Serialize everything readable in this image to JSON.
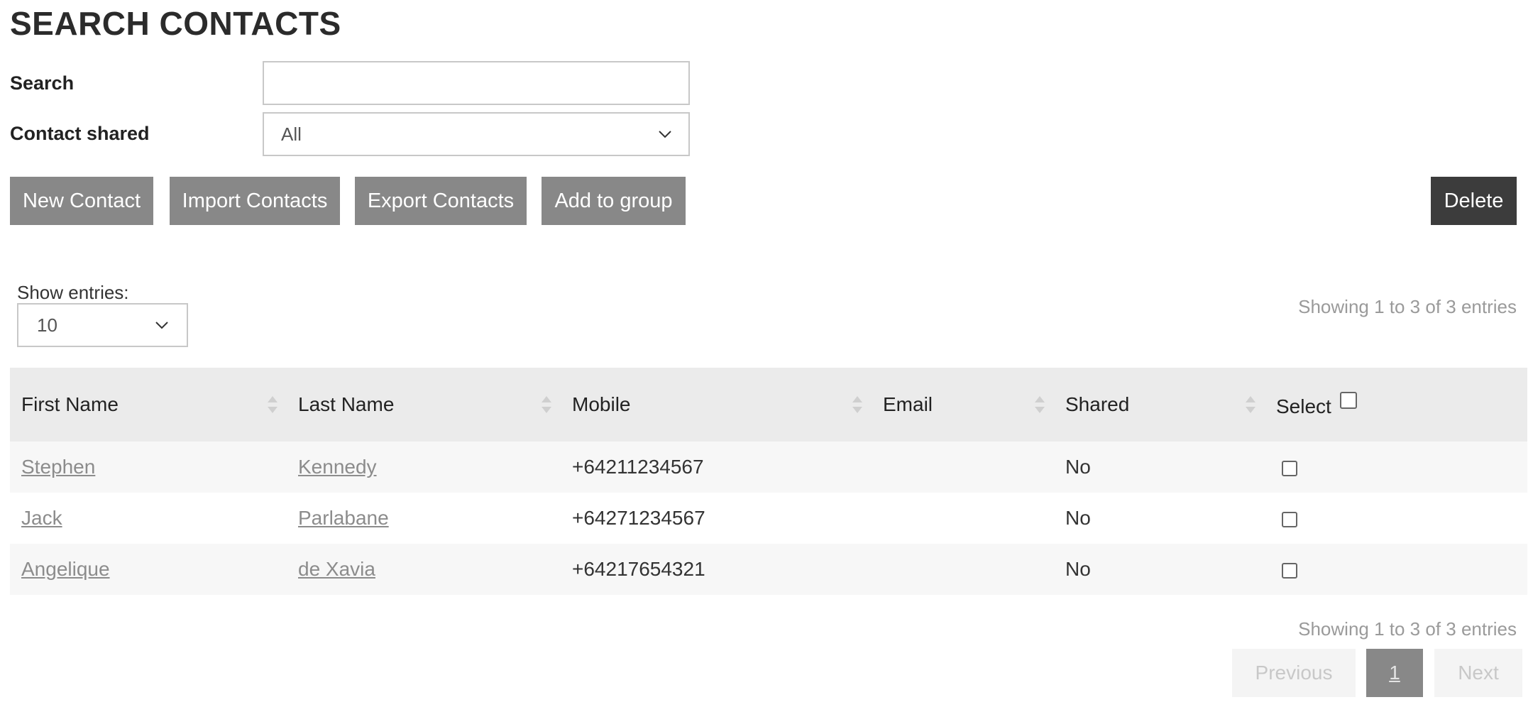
{
  "page": {
    "title": "SEARCH CONTACTS"
  },
  "filters": {
    "search_label": "Search",
    "search_value": "",
    "shared_label": "Contact shared",
    "shared_value": "All"
  },
  "toolbar": {
    "new_contact": "New Contact",
    "import_contacts": "Import Contacts",
    "export_contacts": "Export Contacts",
    "add_to_group": "Add to group",
    "delete": "Delete"
  },
  "entries": {
    "label": "Show entries:",
    "value": "10",
    "info": "Showing 1 to 3 of 3 entries"
  },
  "table": {
    "columns": [
      "First Name",
      "Last Name",
      "Mobile",
      "Email",
      "Shared",
      "Select"
    ],
    "rows": [
      {
        "first_name": "Stephen",
        "last_name": "Kennedy",
        "mobile": "+64211234567",
        "email": "",
        "shared": "No",
        "selected": false
      },
      {
        "first_name": "Jack",
        "last_name": "Parlabane",
        "mobile": "+64271234567",
        "email": "",
        "shared": "No",
        "selected": false
      },
      {
        "first_name": "Angelique",
        "last_name": "de Xavia",
        "mobile": "+64217654321",
        "email": "",
        "shared": "No",
        "selected": false
      }
    ]
  },
  "pagination": {
    "previous": "Previous",
    "current_page": "1",
    "next": "Next"
  },
  "icons": {
    "select_chevron": "chevron-down-icon",
    "sort": "sort-icon"
  },
  "colors": {
    "button_bg": "#888888",
    "delete_bg": "#3c3c3c",
    "header_bg": "#ebebeb",
    "link": "#8c8c8c"
  }
}
